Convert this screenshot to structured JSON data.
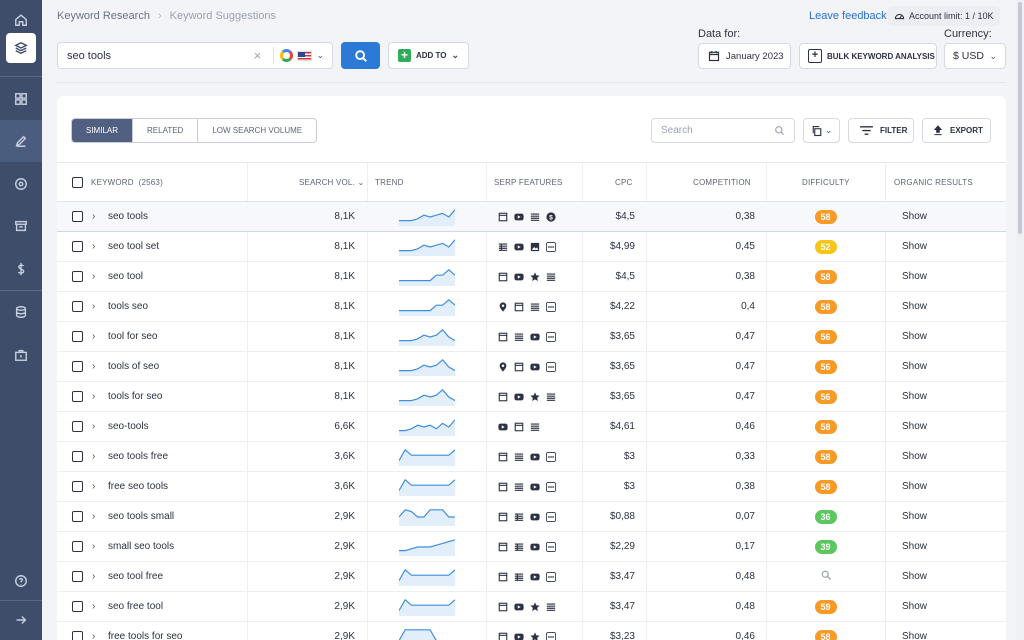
{
  "sidebar": {
    "items": [
      {
        "icon": "home-icon"
      },
      {
        "icon": "layers-icon",
        "active": true
      },
      {
        "icon": "grid-icon"
      },
      {
        "icon": "edit-icon",
        "highlighted": true
      },
      {
        "icon": "target-icon"
      },
      {
        "icon": "archive-icon"
      },
      {
        "icon": "dollar-icon"
      },
      {
        "icon": "database-icon"
      },
      {
        "icon": "briefcase-icon"
      },
      {
        "icon": "help-icon"
      },
      {
        "icon": "logout-arrow-icon"
      }
    ]
  },
  "breadcrumb": {
    "items": [
      "Keyword Research",
      "Keyword Suggestions"
    ],
    "separator": "›"
  },
  "header": {
    "feedback": "Leave feedback",
    "account_limit": "Account limit: 1 / 10K",
    "data_for_label": "Data for:",
    "date": "January 2023",
    "bulk": "BULK KEYWORD ANALYSIS",
    "currency_label": "Currency:",
    "currency": "$ USD"
  },
  "search": {
    "value": "seo tools",
    "clear": "×",
    "add_to": "ADD TO"
  },
  "tabs": [
    "SIMILAR",
    "RELATED",
    "LOW SEARCH VOLUME"
  ],
  "toolbar": {
    "search_placeholder": "Search",
    "filter": "FILTER",
    "export": "EXPORT"
  },
  "table": {
    "headers": {
      "keyword": "KEYWORD",
      "count": "(2563)",
      "search_vol": "SEARCH VOL.",
      "trend": "TREND",
      "serp": "SERP FEATURES",
      "cpc": "CPC",
      "competition": "COMPETITION",
      "difficulty": "DIFFICULTY",
      "organic": "ORGANIC RESULTS"
    },
    "rows": [
      {
        "keyword": "seo tools",
        "vol": "8,1K",
        "trend": [
          3,
          3,
          3,
          4,
          6,
          5,
          6,
          7,
          5,
          9
        ],
        "serp": [
          "doc",
          "video",
          "list",
          "dollar"
        ],
        "cpc": "$4,5",
        "comp": "0,38",
        "diff": "58",
        "dc": "#f79a26",
        "show": "Show"
      },
      {
        "keyword": "seo tool set",
        "vol": "8,1K",
        "trend": [
          3,
          3,
          3,
          4,
          6,
          5,
          6,
          7,
          5,
          9
        ],
        "serp": [
          "table",
          "video",
          "image",
          "more"
        ],
        "cpc": "$4,99",
        "comp": "0,45",
        "diff": "52",
        "dc": "#f5c518",
        "show": "Show"
      },
      {
        "keyword": "seo tool",
        "vol": "8,1K",
        "trend": [
          3,
          3,
          3,
          3,
          3,
          3,
          6,
          6,
          9,
          6
        ],
        "serp": [
          "doc",
          "video",
          "star",
          "list"
        ],
        "cpc": "$4,5",
        "comp": "0,38",
        "diff": "58",
        "dc": "#f79a26",
        "show": "Show"
      },
      {
        "keyword": "tools seo",
        "vol": "8,1K",
        "trend": [
          3,
          3,
          3,
          3,
          3,
          3,
          6,
          6,
          9,
          6
        ],
        "serp": [
          "pin",
          "doc",
          "list",
          "more"
        ],
        "cpc": "$4,22",
        "comp": "0,4",
        "diff": "58",
        "dc": "#f79a26",
        "show": "Show"
      },
      {
        "keyword": "tool for seo",
        "vol": "8,1K",
        "trend": [
          3,
          3,
          3,
          4,
          6,
          5,
          6,
          9,
          5,
          3
        ],
        "serp": [
          "doc",
          "list",
          "video",
          "more"
        ],
        "cpc": "$3,65",
        "comp": "0,47",
        "diff": "56",
        "dc": "#f79a26",
        "show": "Show"
      },
      {
        "keyword": "tools of seo",
        "vol": "8,1K",
        "trend": [
          3,
          3,
          3,
          4,
          6,
          5,
          6,
          9,
          5,
          3
        ],
        "serp": [
          "pin",
          "doc",
          "video",
          "more"
        ],
        "cpc": "$3,65",
        "comp": "0,47",
        "diff": "56",
        "dc": "#f79a26",
        "show": "Show"
      },
      {
        "keyword": "tools for seo",
        "vol": "8,1K",
        "trend": [
          3,
          3,
          3,
          4,
          6,
          5,
          6,
          9,
          5,
          3
        ],
        "serp": [
          "doc",
          "video",
          "star",
          "list"
        ],
        "cpc": "$3,65",
        "comp": "0,47",
        "diff": "56",
        "dc": "#f79a26",
        "show": "Show"
      },
      {
        "keyword": "seo-tools",
        "vol": "6,6K",
        "trend": [
          3,
          3,
          4,
          6,
          5,
          6,
          4,
          7,
          5,
          9
        ],
        "serp": [
          "video",
          "doc",
          "list"
        ],
        "cpc": "$4,61",
        "comp": "0,46",
        "diff": "58",
        "dc": "#f79a26",
        "show": "Show"
      },
      {
        "keyword": "seo tools free",
        "vol": "3,6K",
        "trend": [
          3,
          9,
          6,
          6,
          6,
          6,
          6,
          6,
          6,
          9
        ],
        "serp": [
          "doc",
          "list",
          "video",
          "more"
        ],
        "cpc": "$3",
        "comp": "0,33",
        "diff": "58",
        "dc": "#f79a26",
        "show": "Show"
      },
      {
        "keyword": "free seo tools",
        "vol": "3,6K",
        "trend": [
          3,
          9,
          6,
          6,
          6,
          6,
          6,
          6,
          6,
          9
        ],
        "serp": [
          "doc",
          "list",
          "video",
          "more"
        ],
        "cpc": "$3",
        "comp": "0,38",
        "diff": "58",
        "dc": "#f79a26",
        "show": "Show"
      },
      {
        "keyword": "seo tools small",
        "vol": "2,9K",
        "trend": [
          5,
          9,
          8,
          5,
          5,
          9,
          9,
          9,
          5,
          5
        ],
        "serp": [
          "doc",
          "table",
          "video",
          "more"
        ],
        "cpc": "$0,88",
        "comp": "0,07",
        "diff": "36",
        "dc": "#5cc75e",
        "show": "Show"
      },
      {
        "keyword": "small seo tools",
        "vol": "2,9K",
        "trend": [
          3,
          3,
          4,
          5,
          5,
          5,
          6,
          7,
          8,
          9
        ],
        "serp": [
          "doc",
          "table",
          "video",
          "more"
        ],
        "cpc": "$2,29",
        "comp": "0,17",
        "diff": "39",
        "dc": "#5cc75e",
        "show": "Show"
      },
      {
        "keyword": "seo tool free",
        "vol": "2,9K",
        "trend": [
          3,
          9,
          6,
          6,
          6,
          6,
          6,
          6,
          6,
          9
        ],
        "serp": [
          "doc",
          "table",
          "video",
          "more"
        ],
        "cpc": "$3,47",
        "comp": "0,48",
        "diff": "",
        "dc": "",
        "show": "Show"
      },
      {
        "keyword": "seo free tool",
        "vol": "2,9K",
        "trend": [
          3,
          9,
          6,
          6,
          6,
          6,
          6,
          6,
          6,
          9
        ],
        "serp": [
          "doc",
          "video",
          "star",
          "list"
        ],
        "cpc": "$3,47",
        "comp": "0,48",
        "diff": "59",
        "dc": "#f79a26",
        "show": "Show"
      },
      {
        "keyword": "free tools for seo",
        "vol": "2,9K",
        "trend": [
          3,
          9,
          9,
          9,
          9,
          9,
          3,
          3,
          3,
          3
        ],
        "serp": [
          "doc",
          "video",
          "star",
          "more"
        ],
        "cpc": "$3,23",
        "comp": "0,46",
        "diff": "58",
        "dc": "#f79a26",
        "show": "Show"
      }
    ]
  }
}
